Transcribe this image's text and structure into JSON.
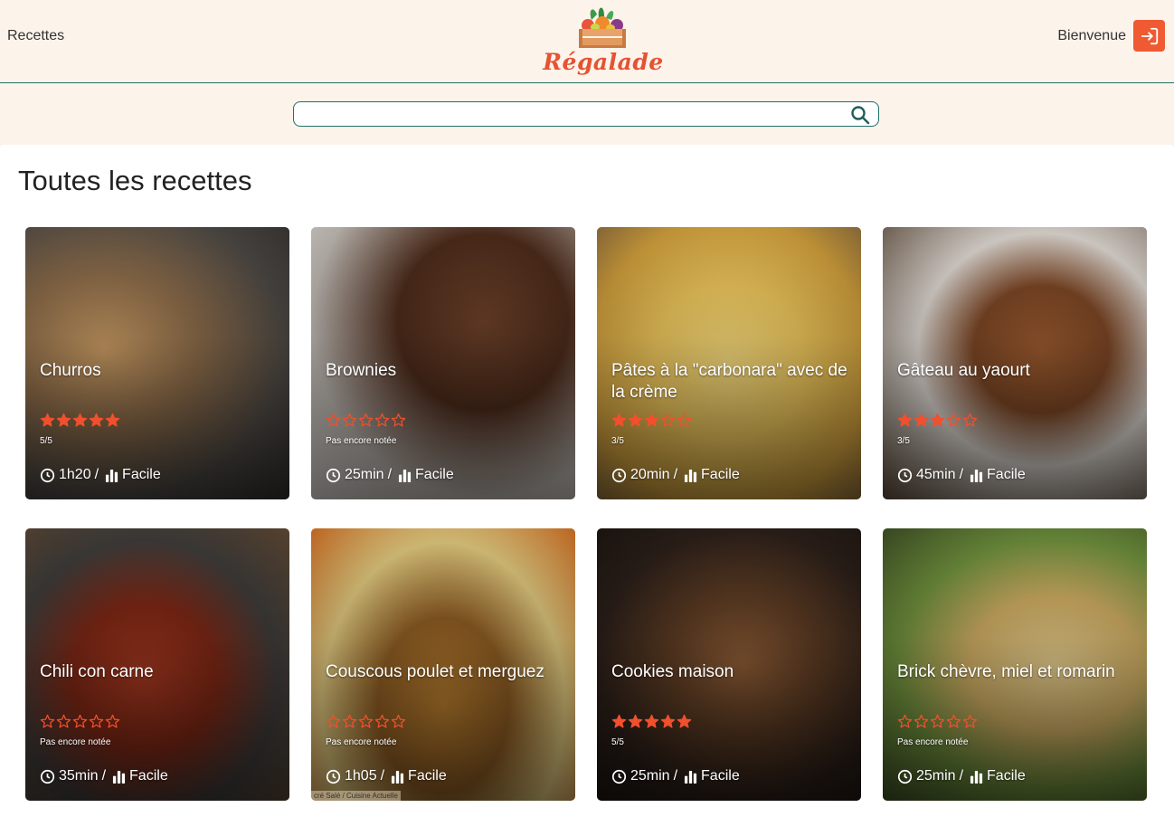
{
  "header": {
    "nav_recipes": "Recettes",
    "logo_text": "Régalade",
    "welcome": "Bienvenue"
  },
  "search": {
    "value": "",
    "placeholder": ""
  },
  "main": {
    "title": "Toutes les recettes"
  },
  "recipes": [
    {
      "title": "Churros",
      "rating": 5,
      "rating_text": "5/5",
      "duration": "1h20",
      "difficulty": "Facile",
      "separator": "/"
    },
    {
      "title": "Brownies",
      "rating": 0,
      "rating_text": "Pas encore notée",
      "duration": "25min",
      "difficulty": "Facile",
      "separator": "/"
    },
    {
      "title": "Pâtes à la \"carbonara\" avec de la crème",
      "rating": 3,
      "rating_text": "3/5",
      "duration": "20min",
      "difficulty": "Facile",
      "separator": "/"
    },
    {
      "title": "Gâteau au yaourt",
      "rating": 3,
      "rating_text": "3/5",
      "duration": "45min",
      "difficulty": "Facile",
      "separator": "/"
    },
    {
      "title": "Chili con carne",
      "rating": 0,
      "rating_text": "Pas encore notée",
      "duration": "35min",
      "difficulty": "Facile",
      "separator": "/"
    },
    {
      "title": "Couscous poulet et merguez",
      "rating": 0,
      "rating_text": "Pas encore notée",
      "duration": "1h05",
      "difficulty": "Facile",
      "separator": "/",
      "photo_credit": "cré Salé / Cuisine Actuelle"
    },
    {
      "title": "Cookies maison",
      "rating": 5,
      "rating_text": "5/5",
      "duration": "25min",
      "difficulty": "Facile",
      "separator": "/"
    },
    {
      "title": "Brick chèvre, miel et romarin",
      "rating": 0,
      "rating_text": "Pas encore notée",
      "duration": "25min",
      "difficulty": "Facile",
      "separator": "/"
    }
  ],
  "colors": {
    "background": "#fcf3ea",
    "accent": "#f05a32",
    "teal": "#1f6f6a",
    "star": "#f0502d"
  },
  "icons": {
    "login": "login-icon",
    "search": "search-icon",
    "clock": "clock-icon",
    "difficulty": "bar-chart-icon",
    "star": "star-icon"
  }
}
